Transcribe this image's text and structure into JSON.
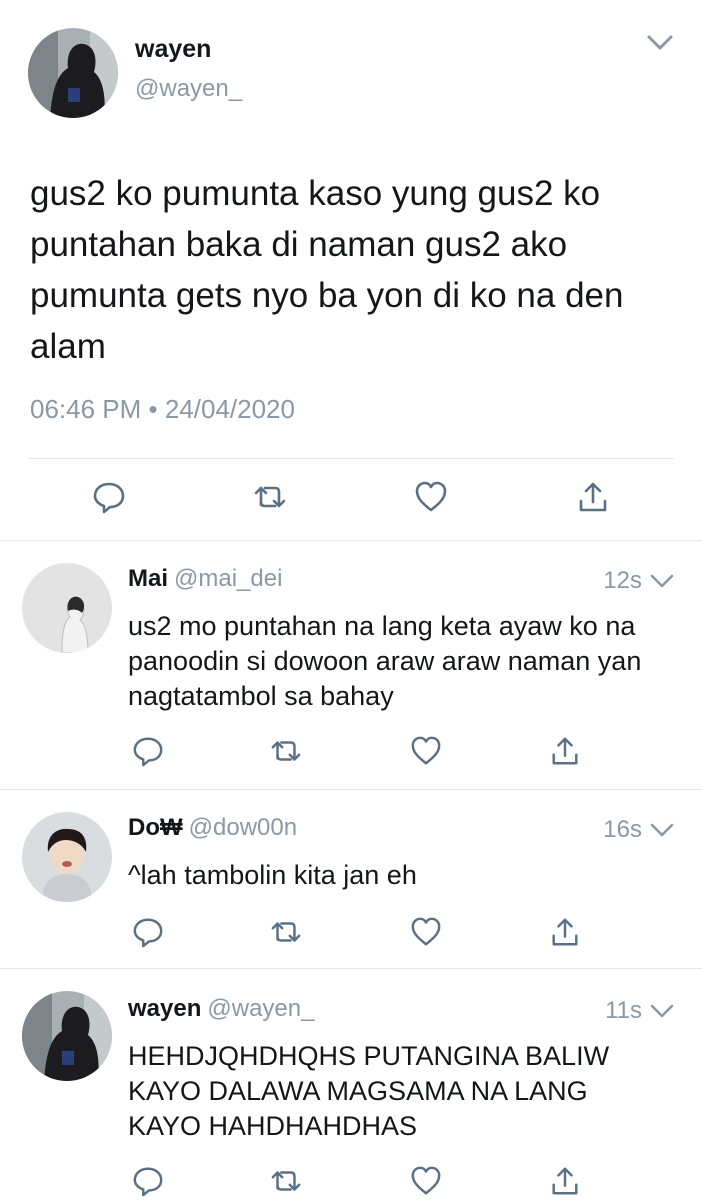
{
  "main_tweet": {
    "name": "wayen",
    "handle": "@wayen_",
    "text": "gus2 ko pumunta kaso yung gus2 ko puntahan baka di naman gus2 ako pumunta gets nyo ba yon di ko na den alam",
    "timestamp": "06:46 PM • 24/04/2020",
    "icons": [
      "chevron-down-icon",
      "reply-icon",
      "retweet-icon",
      "like-icon",
      "share-icon"
    ]
  },
  "replies": [
    {
      "name": "Mai",
      "handle": "@mai_dei",
      "time": "12s",
      "text": "us2 mo puntahan na lang keta ayaw ko na panoodin si dowoon araw araw naman yan nagtatambol sa bahay"
    },
    {
      "name": "Do₩",
      "handle": "@dow00n",
      "time": "16s",
      "text": "^lah tambolin kita jan eh"
    },
    {
      "name": "wayen",
      "handle": "@wayen_",
      "time": "11s",
      "text": "HEHDJQHDHQHS PUTANGINA BALIW KAYO DALAWA MAGSAMA NA LANG KAYO HAHDHAHDHAS"
    }
  ],
  "colors": {
    "text": "#14171a",
    "secondary": "#8b98a5",
    "icon": "#5b7083",
    "divider": "#e1e8ed"
  }
}
